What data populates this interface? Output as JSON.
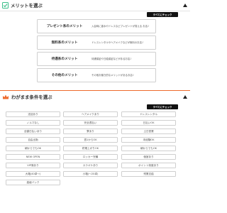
{
  "merit_section": {
    "title": "メリットを選ぶ",
    "check_all": "すべてにチェック",
    "icon": "checkbox-icon",
    "accent": "#3bbf8a",
    "items": [
      {
        "name": "プレゼント系のメリット",
        "desc": "入会時に香水やドレスなどプレゼントが貰える お店♪"
      },
      {
        "name": "無料系のメリット",
        "desc": "ドレスレンタルやヘアメイクなどが無料のお店♪"
      },
      {
        "name": "待遇系のメリット",
        "desc": "待遇保証や日給保証などがあるお店♪"
      },
      {
        "name": "その他のメリット",
        "desc": "その他お働き的なメリットがあるお店♪"
      }
    ]
  },
  "conditions_section": {
    "title": "わがまま条件を選ぶ",
    "check_all": "すべてにチェック",
    "icon": "crown-icon",
    "accent": "#ee6a2c",
    "items": [
      "送迎あり",
      "ヘアメイクあり",
      "ドレスレンタル",
      "ノルマなし",
      "完全週払い",
      "日払いOK",
      "全額日払いあり",
      "寮あり",
      "土日営業",
      "自由出勤",
      "週1からOK",
      "未経験OK",
      "朝からでもOK",
      "終電上がりOK",
      "朝からでもOK",
      "NEW OPEN",
      "ロッカー完備",
      "個室あり",
      "VIP席あり",
      "カラオケあり",
      "ポイント制度あり",
      "大箱(40卓〜)",
      "小箱(〜20卓)",
      "残業支給",
      "高級バック"
    ]
  }
}
